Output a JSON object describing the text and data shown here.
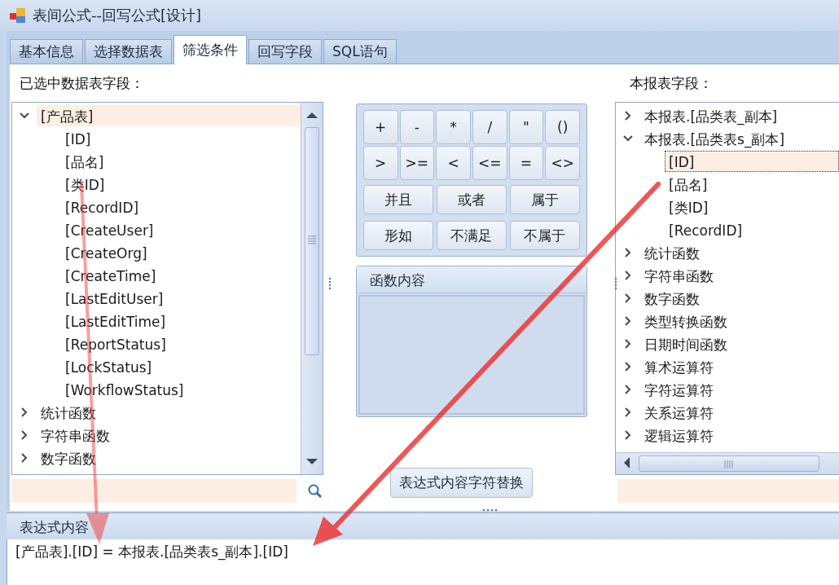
{
  "window": {
    "title": "表间公式--回写公式[设计]"
  },
  "tabs": [
    {
      "label": "基本信息",
      "selected": false
    },
    {
      "label": "选择数据表",
      "selected": false
    },
    {
      "label": "筛选条件",
      "selected": true
    },
    {
      "label": "回写字段",
      "selected": false
    },
    {
      "label": "SQL语句",
      "selected": false
    }
  ],
  "left_panel": {
    "label": "已选中数据表字段：",
    "tree": [
      {
        "label": "[产品表]",
        "expanded": true,
        "selected": true,
        "children": [
          {
            "label": "[ID]",
            "selected": false
          },
          {
            "label": "[品名]",
            "selected": false
          },
          {
            "label": "[类ID]",
            "selected": false
          },
          {
            "label": "[RecordID]",
            "selected": false
          },
          {
            "label": "[CreateUser]",
            "selected": false
          },
          {
            "label": "[CreateOrg]",
            "selected": false
          },
          {
            "label": "[CreateTime]",
            "selected": false
          },
          {
            "label": "[LastEditUser]",
            "selected": false
          },
          {
            "label": "[LastEditTime]",
            "selected": false
          },
          {
            "label": "[ReportStatus]",
            "selected": false
          },
          {
            "label": "[LockStatus]",
            "selected": false
          },
          {
            "label": "[WorkflowStatus]",
            "selected": false
          }
        ]
      },
      {
        "label": "统计函数",
        "expanded": false,
        "selected": false
      },
      {
        "label": "字符串函数",
        "expanded": false,
        "selected": false
      },
      {
        "label": "数字函数",
        "expanded": false,
        "selected": false
      }
    ]
  },
  "operator_buttons": [
    "+",
    "-",
    "*",
    "/",
    "\"",
    "()",
    ">",
    ">=",
    "<",
    "<=",
    "=",
    "<>"
  ],
  "logic_buttons": [
    "并且",
    "或者",
    "属于",
    "形如",
    "不满足",
    "不属于"
  ],
  "function_panel": {
    "title": "函数内容"
  },
  "replace_button": "表达式内容字符替换",
  "right_panel": {
    "label": "本报表字段：",
    "tree": [
      {
        "label": "本报表.[品类表_副本]",
        "expanded": false,
        "selected": false
      },
      {
        "label": "本报表.[品类表s_副本]",
        "expanded": true,
        "selected": false,
        "children": [
          {
            "label": "[ID]",
            "selected": true
          },
          {
            "label": "[品名]",
            "selected": false
          },
          {
            "label": "[类ID]",
            "selected": false
          },
          {
            "label": "[RecordID]",
            "selected": false
          }
        ]
      },
      {
        "label": "统计函数",
        "expanded": false,
        "selected": false
      },
      {
        "label": "字符串函数",
        "expanded": false,
        "selected": false
      },
      {
        "label": "数字函数",
        "expanded": false,
        "selected": false
      },
      {
        "label": "类型转换函数",
        "expanded": false,
        "selected": false
      },
      {
        "label": "日期时间函数",
        "expanded": false,
        "selected": false
      },
      {
        "label": "算术运算符",
        "expanded": false,
        "selected": false
      },
      {
        "label": "字符运算符",
        "expanded": false,
        "selected": false
      },
      {
        "label": "关系运算符",
        "expanded": false,
        "selected": false
      },
      {
        "label": "逻辑运算符",
        "expanded": false,
        "selected": false
      }
    ]
  },
  "expression": {
    "title": "表达式内容",
    "value": "[产品表].[ID] = 本报表.[品类表s_副本].[ID]"
  }
}
